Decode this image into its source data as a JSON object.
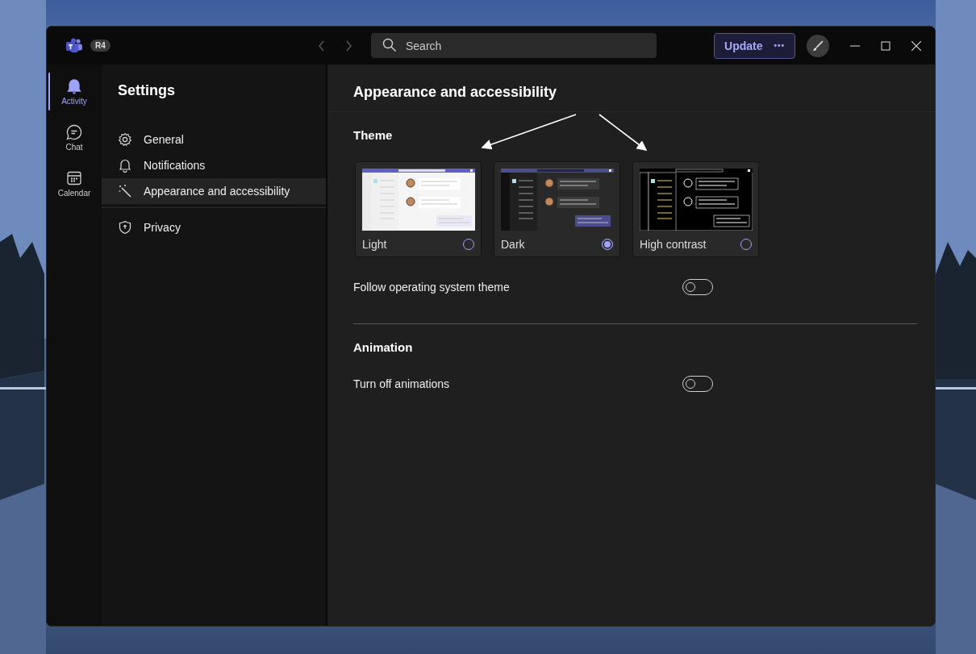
{
  "app_bar": {
    "badge": "R4",
    "search": {
      "placeholder": "Search"
    },
    "update_button": "Update",
    "more": "•••"
  },
  "rail": [
    {
      "label": "Activity",
      "selected": true
    },
    {
      "label": "Chat",
      "selected": false
    },
    {
      "label": "Calendar",
      "selected": false
    }
  ],
  "settings": {
    "title": "Settings",
    "items": [
      {
        "label": "General",
        "selected": false
      },
      {
        "label": "Notifications",
        "selected": false
      },
      {
        "label": "Appearance and accessibility",
        "selected": true
      },
      {
        "label": "Privacy",
        "selected": false
      }
    ]
  },
  "page": {
    "title": "Appearance and accessibility",
    "theme": {
      "heading": "Theme",
      "options": [
        {
          "label": "Light",
          "kind": "light",
          "selected": false
        },
        {
          "label": "Dark",
          "kind": "dark",
          "selected": true
        },
        {
          "label": "High contrast",
          "kind": "contrast",
          "selected": false
        }
      ]
    },
    "follow_os": {
      "label": "Follow operating system theme",
      "on": false
    },
    "animation": {
      "heading": "Animation",
      "turn_off": {
        "label": "Turn off animations",
        "on": false
      }
    }
  }
}
